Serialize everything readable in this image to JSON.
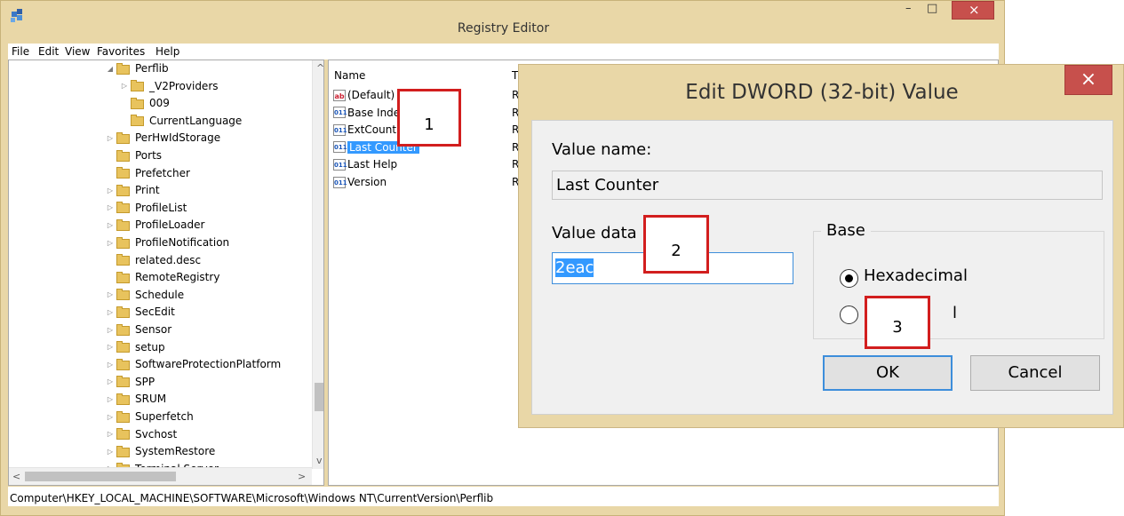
{
  "window": {
    "title": "Registry Editor",
    "minimize_glyph": "–",
    "maximize_glyph": "□",
    "close_glyph": "×",
    "icon": "registry-editor-icon"
  },
  "menu": [
    "File",
    "Edit",
    "View",
    "Favorites",
    "Help"
  ],
  "tree": {
    "items": [
      {
        "label": "Perflib",
        "expander": "◢"
      },
      {
        "label": "_V2Providers",
        "expander": "▷"
      },
      {
        "label": "009",
        "expander": ""
      },
      {
        "label": "CurrentLanguage",
        "expander": ""
      },
      {
        "label": "PerHwIdStorage",
        "expander": "▷"
      },
      {
        "label": "Ports",
        "expander": ""
      },
      {
        "label": "Prefetcher",
        "expander": ""
      },
      {
        "label": "Print",
        "expander": "▷"
      },
      {
        "label": "ProfileList",
        "expander": "▷"
      },
      {
        "label": "ProfileLoader",
        "expander": "▷"
      },
      {
        "label": "ProfileNotification",
        "expander": "▷"
      },
      {
        "label": "related.desc",
        "expander": ""
      },
      {
        "label": "RemoteRegistry",
        "expander": ""
      },
      {
        "label": "Schedule",
        "expander": "▷"
      },
      {
        "label": "SecEdit",
        "expander": "▷"
      },
      {
        "label": "Sensor",
        "expander": "▷"
      },
      {
        "label": "setup",
        "expander": "▷"
      },
      {
        "label": "SoftwareProtectionPlatform",
        "expander": "▷"
      },
      {
        "label": "SPP",
        "expander": "▷"
      },
      {
        "label": "SRUM",
        "expander": "▷"
      },
      {
        "label": "Superfetch",
        "expander": "▷"
      },
      {
        "label": "Svchost",
        "expander": "▷"
      },
      {
        "label": "SystemRestore",
        "expander": "▷"
      },
      {
        "label": "Terminal Server",
        "expander": "▷"
      }
    ],
    "scroll_up": "^",
    "scroll_down": "v",
    "scroll_left": "<",
    "scroll_right": ">"
  },
  "values_list": {
    "columns": {
      "name": "Name",
      "type": "T"
    },
    "rows": [
      {
        "name": "(Default)",
        "type": "R",
        "kind": "sz",
        "icon_text": "ab"
      },
      {
        "name": "Base Inde",
        "type": "R",
        "kind": "dw",
        "icon_text": "011"
      },
      {
        "name": "ExtCount",
        "type": "R",
        "kind": "dw",
        "icon_text": "011"
      },
      {
        "name": "Last Counter",
        "type": "R",
        "kind": "dw",
        "icon_text": "011"
      },
      {
        "name": "Last Help",
        "type": "R",
        "kind": "dw",
        "icon_text": "011"
      },
      {
        "name": "Version",
        "type": "R",
        "kind": "dw",
        "icon_text": "011"
      }
    ]
  },
  "status": {
    "path": "Computer\\HKEY_LOCAL_MACHINE\\SOFTWARE\\Microsoft\\Windows NT\\CurrentVersion\\Perflib"
  },
  "dialog": {
    "title": "Edit DWORD (32-bit) Value",
    "close_glyph": "×",
    "value_name_label": "Value name:",
    "value_name": "Last Counter",
    "value_data_label": "Value data",
    "value_data": "2eac",
    "base_label": "Base",
    "radio_hex": "Hexadecimal",
    "radio_dec_partial": "l",
    "ok": "OK",
    "cancel": "Cancel"
  },
  "annotations": [
    "1",
    "2",
    "3"
  ],
  "colors": {
    "accent": "#3399ff",
    "annotation_red": "#d21e1e",
    "window_frame": "#e9d7a7",
    "close_red": "#c7504c"
  }
}
